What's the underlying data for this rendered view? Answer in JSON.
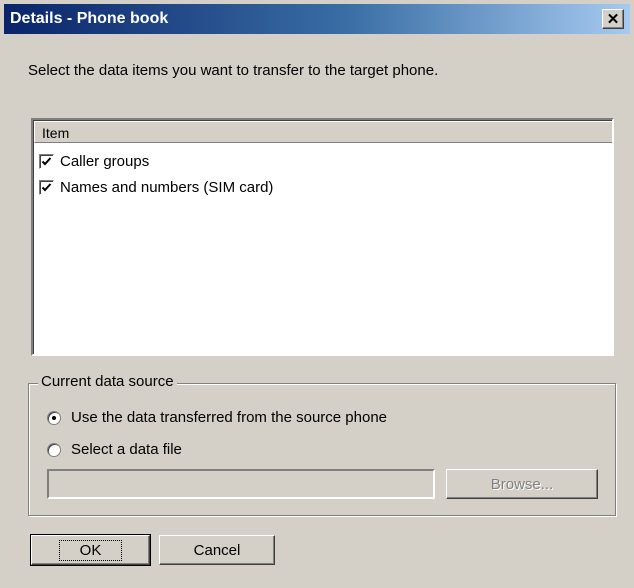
{
  "window": {
    "title": "Details - Phone book",
    "close_glyph": "✕"
  },
  "instruction": "Select the data items you want to transfer to the target phone.",
  "list": {
    "column_header": "Item",
    "items": [
      {
        "label": "Caller groups",
        "checked": true
      },
      {
        "label": "Names and numbers (SIM card)",
        "checked": true
      }
    ]
  },
  "data_source": {
    "legend": "Current data source",
    "options": [
      {
        "label": "Use the data transferred from the source phone",
        "selected": true
      },
      {
        "label": "Select a data file",
        "selected": false
      }
    ],
    "file_path_value": "",
    "browse_label": "Browse..."
  },
  "buttons": {
    "ok_label": "OK",
    "cancel_label": "Cancel"
  }
}
